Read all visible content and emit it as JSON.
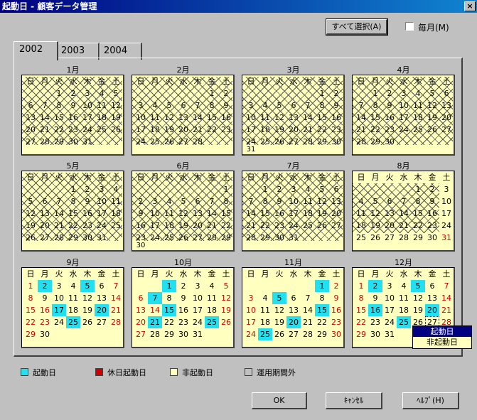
{
  "window": {
    "title": "起動日 - 顧客データ管理",
    "close_glyph": "×"
  },
  "toolbar": {
    "select_all_label": "すべて選択(A)",
    "monthly_label": "毎月(M)",
    "monthly_checked": false
  },
  "tabs": [
    {
      "label": "2002",
      "active": true
    },
    {
      "label": "2003",
      "active": false
    },
    {
      "label": "2004",
      "active": false
    }
  ],
  "weekdays": [
    "日",
    "月",
    "火",
    "水",
    "木",
    "金",
    "土"
  ],
  "months": [
    {
      "label": "1月",
      "start": 2,
      "days": 31,
      "red": [],
      "cyan": [],
      "boxed": null,
      "crossed": true
    },
    {
      "label": "2月",
      "start": 5,
      "days": 28,
      "red": [],
      "cyan": [],
      "boxed": null,
      "crossed": true
    },
    {
      "label": "3月",
      "start": 5,
      "days": 31,
      "red": [],
      "cyan": [],
      "boxed": null,
      "crossed": true
    },
    {
      "label": "4月",
      "start": 1,
      "days": 30,
      "red": [],
      "cyan": [],
      "boxed": null,
      "crossed": true
    },
    {
      "label": "5月",
      "start": 3,
      "days": 31,
      "red": [],
      "cyan": [],
      "boxed": null,
      "crossed": true
    },
    {
      "label": "6月",
      "start": 6,
      "days": 30,
      "red": [],
      "cyan": [],
      "boxed": null,
      "crossed": true
    },
    {
      "label": "7月",
      "start": 1,
      "days": 31,
      "red": [],
      "cyan": [],
      "boxed": null,
      "crossed": true
    },
    {
      "label": "8月",
      "start": 4,
      "days": 31,
      "red": [
        31
      ],
      "cyan": [],
      "boxed": null,
      "crossed": false,
      "partial_cross": true
    },
    {
      "label": "9月",
      "start": 0,
      "days": 30,
      "red": [
        1,
        8,
        15,
        16,
        22,
        23,
        28,
        29,
        7,
        14,
        21
      ],
      "cyan": [
        2,
        5,
        17,
        20,
        25
      ],
      "boxed": null,
      "crossed": false
    },
    {
      "label": "10月",
      "start": 2,
      "days": 31,
      "red": [
        5,
        6,
        12,
        13,
        14,
        19,
        20,
        26,
        27
      ],
      "cyan": [
        1,
        7,
        15,
        21,
        25
      ],
      "boxed": null,
      "crossed": false
    },
    {
      "label": "11月",
      "start": 5,
      "days": 30,
      "red": [
        2,
        3,
        9,
        10,
        16,
        17,
        23,
        24,
        30
      ],
      "cyan": [
        1,
        5,
        15,
        20,
        25
      ],
      "boxed": null,
      "crossed": false
    },
    {
      "label": "12月",
      "start": 0,
      "days": 31,
      "red": [
        1,
        7,
        8,
        14,
        15,
        21,
        22,
        28,
        29
      ],
      "cyan": [
        2,
        5,
        16,
        20,
        25
      ],
      "boxed": 27,
      "crossed": false
    }
  ],
  "context_menu": {
    "items": [
      "起動日",
      "非起動日"
    ],
    "selected": 0
  },
  "legend": [
    {
      "label": "起動日",
      "color": "#22e0f0"
    },
    {
      "label": "休日起動日",
      "color": "#d00000"
    },
    {
      "label": "非起動日",
      "color": "#ffffc0"
    },
    {
      "label": "運用期間外",
      "color": "#c0c0c0"
    }
  ],
  "buttons": {
    "ok": "OK",
    "cancel": "ｷｬﾝｾﾙ",
    "help": "ﾍﾙﾌﾟ(H)"
  },
  "colors": {
    "holiday": "#d00000",
    "startup": "#22e0f0",
    "non_startup": "#ffffc0"
  }
}
